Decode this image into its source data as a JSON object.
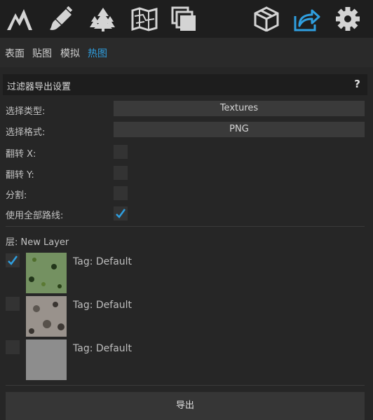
{
  "toolbar": {
    "icons": [
      "mountain-icon",
      "brush-icon",
      "trees-icon",
      "map-icon",
      "layers-icon",
      "cube-icon",
      "export-share-icon",
      "gear-icon"
    ],
    "active_icon": "export-share-icon",
    "accent_color": "#2f9fe0"
  },
  "subnav": {
    "tabs": [
      "表面",
      "贴图",
      "模拟",
      "热图"
    ],
    "active_tab": "热图"
  },
  "panel": {
    "title": "过滤器导出设置",
    "help": "?"
  },
  "settings": {
    "type_label": "选择类型:",
    "type_value": "Textures",
    "format_label": "选择格式:",
    "format_value": "PNG",
    "flip_x_label": "翻转 X:",
    "flip_x_checked": false,
    "flip_y_label": "翻转 Y:",
    "flip_y_checked": false,
    "split_label": "分割:",
    "split_checked": false,
    "all_paths_label": "使用全部路线:",
    "all_paths_checked": true
  },
  "layer": {
    "label": "层: New Layer",
    "items": [
      {
        "tag": "Tag: Default",
        "checked": true,
        "thumbnail": "grass texture"
      },
      {
        "tag": "Tag: Default",
        "checked": false,
        "thumbnail": "rock texture"
      },
      {
        "tag": "Tag: Default",
        "checked": false,
        "thumbnail": "flat gray"
      }
    ]
  },
  "export_button": "导出"
}
